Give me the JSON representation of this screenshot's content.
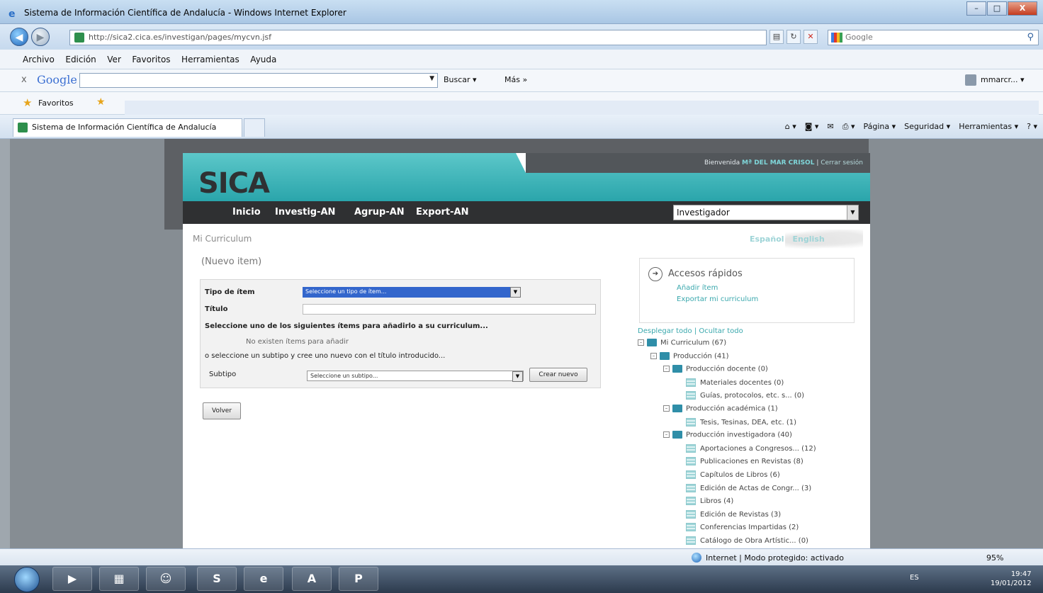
{
  "window": {
    "title": "Sistema de Información Científica de Andalucía - Windows Internet Explorer",
    "controls": [
      "–",
      "□",
      "X"
    ]
  },
  "address": {
    "url": "http://sica2.cica.es/investigan/pages/mycvn.jsf",
    "search_engine": "Google"
  },
  "menubar": [
    "Archivo",
    "Edición",
    "Ver",
    "Favoritos",
    "Herramientas",
    "Ayuda"
  ],
  "googlebar": {
    "close": "x",
    "logo": "Google",
    "buscar": "Buscar ▾",
    "mas": "Más »",
    "user": "mmarcr... ▾"
  },
  "favorites": {
    "label": "Favoritos"
  },
  "tab": {
    "title": "Sistema de Información Científica de Andalucía"
  },
  "commandbar": [
    "Página ▾",
    "Seguridad ▾",
    "Herramientas ▾"
  ],
  "site": {
    "logo": "SICA",
    "welcome_prefix": "Bienvenida",
    "user_name": "Mª DEL MAR CRISOL",
    "separator": "|",
    "logout": "Cerrar sesión",
    "nav": [
      "Inicio",
      "Investig-AN",
      "Agrup-AN",
      "Export-AN"
    ],
    "role": "Investigador",
    "colors": {
      "teal": "#2aa5ab",
      "nav_dark": "#2f3032",
      "link": "#3aa8ad"
    }
  },
  "page": {
    "breadcrumb": "Mi Curriculum",
    "lang_es": "Español",
    "lang_en": "English",
    "heading": "(Nuevo item)"
  },
  "form": {
    "tipo_label": "Tipo de ítem",
    "tipo_value": "Seleccione un tipo de ítem...",
    "titulo_label": "Título",
    "instructions": "Seleccione uno de los siguientes ítems para añadirlo a su curriculum...",
    "no_items": "No existen ítems para añadir",
    "or_subtype": "o seleccione un subtipo y cree uno nuevo con el título introducido...",
    "subtipo_label": "Subtipo",
    "subtipo_value": "Seleccione un subtipo...",
    "create_button": "Crear nuevo",
    "back_button": "Volver"
  },
  "quick": {
    "title": "Accesos rápidos",
    "links": [
      "Añadir ítem",
      "Exportar mi curriculum"
    ]
  },
  "tree_actions": {
    "expand": "Desplegar todo",
    "sep": "|",
    "collapse": "Ocultar todo"
  },
  "tree": [
    {
      "label": "Mi Curriculum (67)",
      "level": 0,
      "type": "folder"
    },
    {
      "label": "Producción (41)",
      "level": 1,
      "type": "folder"
    },
    {
      "label": "Producción docente (0)",
      "level": 2,
      "type": "folder"
    },
    {
      "label": "Materiales docentes (0)",
      "level": 3,
      "type": "doc"
    },
    {
      "label": "Guías, protocolos, etc. s... (0)",
      "level": 3,
      "type": "doc"
    },
    {
      "label": "Producción académica (1)",
      "level": 2,
      "type": "folder"
    },
    {
      "label": "Tesis, Tesinas, DEA, etc. (1)",
      "level": 3,
      "type": "doc"
    },
    {
      "label": "Producción investigadora (40)",
      "level": 2,
      "type": "folder"
    },
    {
      "label": "Aportaciones a Congresos... (12)",
      "level": 3,
      "type": "doc"
    },
    {
      "label": "Publicaciones en Revistas (8)",
      "level": 3,
      "type": "doc"
    },
    {
      "label": "Capítulos de Libros (6)",
      "level": 3,
      "type": "doc"
    },
    {
      "label": "Edición de Actas de Congr... (3)",
      "level": 3,
      "type": "doc"
    },
    {
      "label": "Libros (4)",
      "level": 3,
      "type": "doc"
    },
    {
      "label": "Edición de Revistas (3)",
      "level": 3,
      "type": "doc"
    },
    {
      "label": "Conferencias Impartidas (2)",
      "level": 3,
      "type": "doc"
    },
    {
      "label": "Catálogo de Obra Artístic... (0)",
      "level": 3,
      "type": "doc"
    }
  ],
  "status": {
    "zone": "Internet | Modo protegido: activado",
    "zoom": "95%"
  },
  "taskbar": {
    "lang": "ES",
    "time": "19:47",
    "date": "19/01/2012"
  }
}
